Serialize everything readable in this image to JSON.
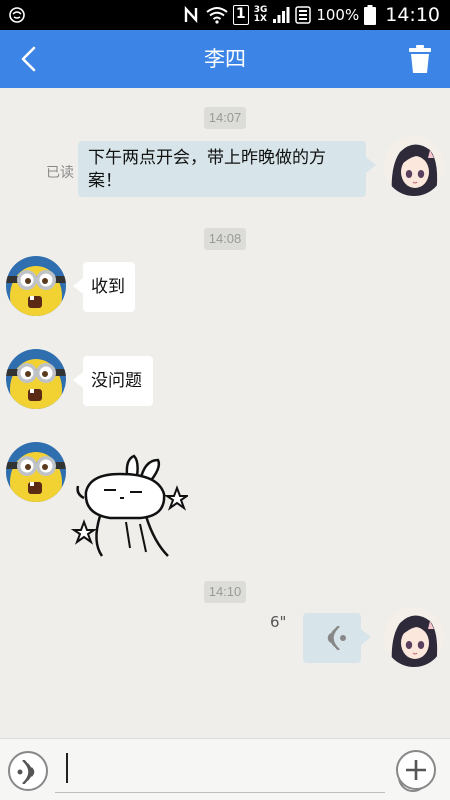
{
  "status_bar": {
    "battery_percent": "100%",
    "time": "14:10",
    "network_top": "3G",
    "network_bottom": "1X",
    "sim_indicator": "1",
    "icons": [
      "notification-icon",
      "nfc-icon",
      "wifi-icon",
      "sim-icon",
      "signal-icon",
      "data-icon",
      "battery-icon"
    ]
  },
  "header": {
    "title": "李四",
    "background": "#3c85e6",
    "back_icon": "chevron-left-icon",
    "delete_icon": "trash-icon"
  },
  "messages": [
    {
      "type": "timestamp",
      "text": "14:07"
    },
    {
      "type": "text",
      "direction": "outgoing",
      "read_status": "已读",
      "lines": [
        "下午两点开会，带上昨晚做的方",
        "案！"
      ],
      "avatar": "girl-avatar"
    },
    {
      "type": "timestamp",
      "text": "14:08"
    },
    {
      "type": "text",
      "direction": "incoming",
      "text": "收到",
      "avatar": "minion-avatar"
    },
    {
      "type": "text",
      "direction": "incoming",
      "text": "没问题",
      "avatar": "minion-avatar"
    },
    {
      "type": "sticker",
      "direction": "incoming",
      "sticker": "rabbit-sticker",
      "avatar": "minion-avatar"
    },
    {
      "type": "timestamp",
      "text": "14:10"
    },
    {
      "type": "voice",
      "direction": "outgoing",
      "duration": "6\"",
      "avatar": "girl-avatar"
    }
  ],
  "input_bar": {
    "voice_icon": "voice-wave-icon",
    "emoji_icon": "smiley-icon",
    "plus_icon": "plus-icon",
    "value": ""
  }
}
